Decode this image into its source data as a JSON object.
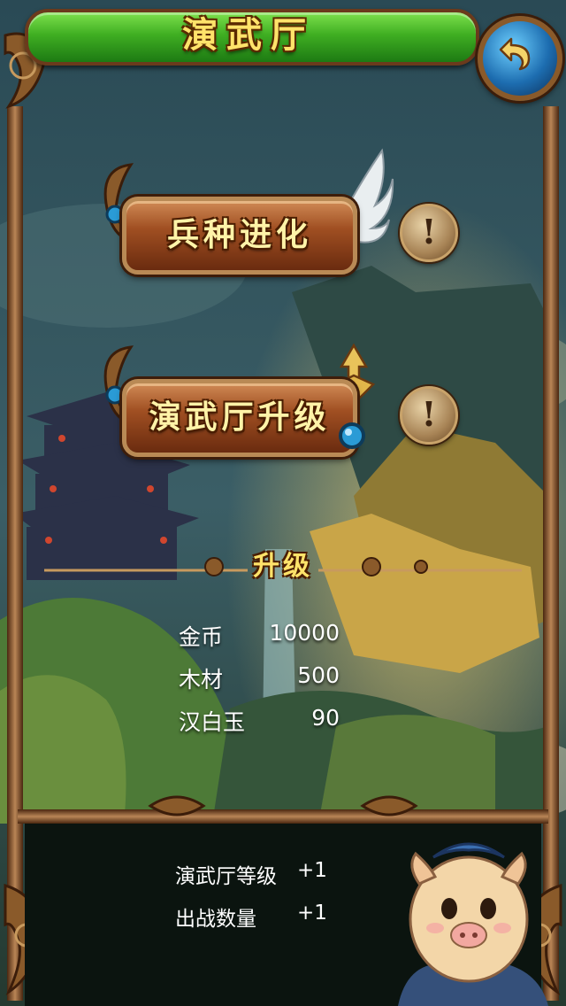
{
  "header": {
    "title": "演武厅",
    "back_icon": "back-arrow-icon"
  },
  "actions": [
    {
      "label": "兵种进化",
      "info_icon": "exclamation-icon"
    },
    {
      "label": "演武厅升级",
      "info_icon": "exclamation-icon"
    }
  ],
  "upgrade": {
    "title": "升级",
    "costs": [
      {
        "name": "金币",
        "amount": "10000"
      },
      {
        "name": "木材",
        "amount": "500"
      },
      {
        "name": "汉白玉",
        "amount": "90"
      }
    ]
  },
  "effects": [
    {
      "name": "演武厅等级",
      "value": "+1"
    },
    {
      "name": "出战数量",
      "value": "+1"
    }
  ],
  "colors": {
    "title_green": "#3fae22",
    "gold_text": "#ffe36a",
    "button_brown": "#a04f22",
    "frame_bronze": "#8a5a2a"
  }
}
